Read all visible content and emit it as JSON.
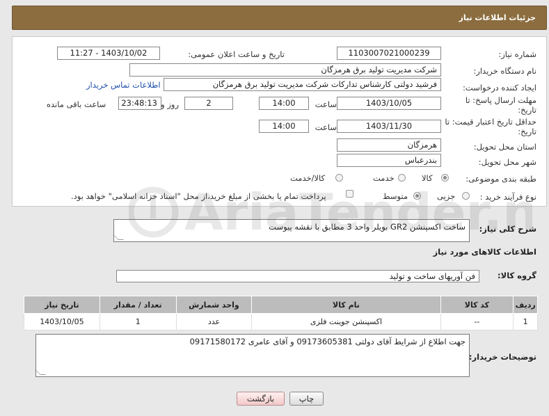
{
  "header": {
    "title": "جزئیات اطلاعات نیاز"
  },
  "form": {
    "need_number_label": "شماره نیاز:",
    "need_number": "1103007021000239",
    "announce_label": "تاریخ و ساعت اعلان عمومی:",
    "announce_value": "1403/10/02 - 11:27",
    "buyer_label": "نام دستگاه خریدار:",
    "buyer_value": "شرکت مدیریت تولید برق هرمزگان",
    "creator_label": "ایجاد کننده درخواست:",
    "creator_value": "فرشید دولتی کارشناس تدارکات شرکت مدیریت تولید برق هرمزگان",
    "contact_link": "اطلاعات تماس خریدار",
    "deadline_label": "مهلت ارسال پاسخ: تا تاریخ:",
    "deadline_date": "1403/10/05",
    "time_label": "ساعت",
    "deadline_time": "14:00",
    "days_value": "2",
    "days_label": "روز و",
    "remaining_time": "23:48:13",
    "remaining_label": "ساعت باقی مانده",
    "validity_label": "حداقل تاریخ اعتبار قیمت: تا تاریخ:",
    "validity_date": "1403/11/30",
    "validity_time": "14:00",
    "province_label": "استان محل تحویل:",
    "province_value": "هرمزگان",
    "city_label": "شهر محل تحویل:",
    "city_value": "بندرعباس",
    "category_label": "طبقه بندی موضوعی:",
    "category_options": [
      "کالا",
      "خدمت",
      "کالا/خدمت"
    ],
    "category_selected": "کالا",
    "process_label": "نوع فرآیند خرید :",
    "process_options": [
      "جزیی",
      "متوسط"
    ],
    "process_selected": "متوسط",
    "payment_note": "پرداخت تمام یا بخشی از مبلغ خرید،از محل \"اسناد خزانه اسلامی\" خواهد بود."
  },
  "description": {
    "label": "شرح کلی نیاز:",
    "value": "ساخت اکسپنشن GR2 بویلر واحد 3 مطابق با نقشه پیوست"
  },
  "goods_section": {
    "title": "اطلاعات کالاهای مورد نیاز",
    "group_label": "گروه کالا:",
    "group_value": "فن آوریهای ساخت و تولید"
  },
  "table": {
    "headers": [
      "ردیف",
      "کد کالا",
      "نام کالا",
      "واحد شمارش",
      "تعداد / مقدار",
      "تاریخ نیاز"
    ],
    "rows": [
      [
        "1",
        "--",
        "اکسپنشن جوینت فلزی",
        "عدد",
        "1",
        "1403/10/05"
      ]
    ]
  },
  "buyer_notes": {
    "label": "توضیحات خریدار:",
    "value": "جهت اطلاع از شرایط آقای دولتی 09173605381 و  آقای عامری 09171580172"
  },
  "buttons": {
    "print": "چاپ",
    "back": "بازگشت"
  },
  "watermark_text": "AriaTender.net",
  "colors": {
    "header_bg": "#8c6d3f",
    "link": "#1e4fa8",
    "table_header": "#bcbcbc"
  }
}
